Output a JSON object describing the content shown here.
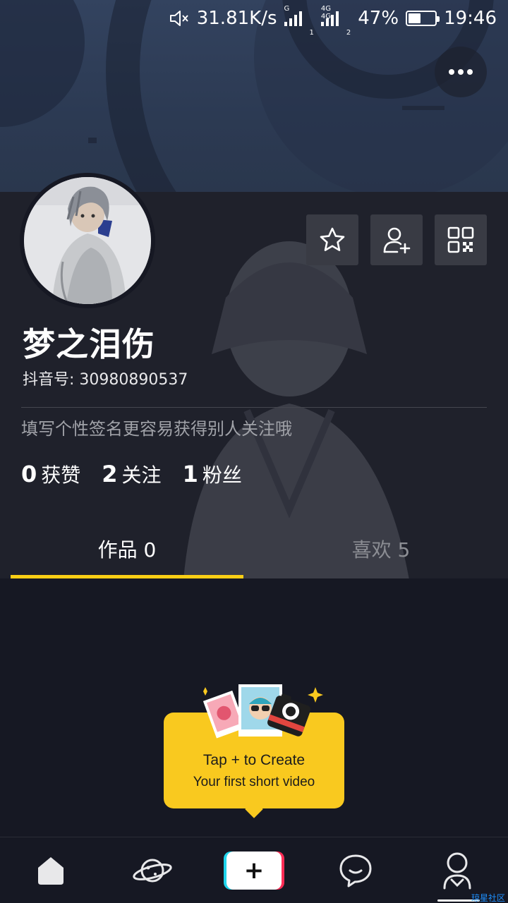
{
  "status_bar": {
    "speed": "31.81K/s",
    "signal1_tag": "G",
    "signal1_sub": "1",
    "signal2_tag": "4G 4G",
    "signal2_sub": "2",
    "battery_percent": "47%",
    "battery_level": 0.47,
    "time": "19:46",
    "icons": [
      "mute-icon",
      "signal-icon",
      "battery-icon"
    ]
  },
  "header": {
    "more_icon": "more-dots-icon"
  },
  "profile": {
    "nickname": "梦之泪伤",
    "douyin_id": "抖音号: 30980890537",
    "bio": "填写个性签名更容易获得别人关注哦",
    "actions": [
      {
        "icon": "star-icon"
      },
      {
        "icon": "add-friend-icon"
      },
      {
        "icon": "qr-code-icon"
      }
    ]
  },
  "stats": [
    {
      "value": "0",
      "label": "获赞"
    },
    {
      "value": "2",
      "label": "关注"
    },
    {
      "value": "1",
      "label": "粉丝"
    }
  ],
  "tabs": [
    {
      "label": "作品 0",
      "active": true
    },
    {
      "label": "喜欢 5",
      "active": false
    }
  ],
  "create_prompt": {
    "line1": "Tap + to Create",
    "line2": "Your first short video"
  },
  "bottom_nav": [
    {
      "icon": "home-icon"
    },
    {
      "icon": "planet-icon"
    },
    {
      "icon": "plus-icon",
      "label": "+"
    },
    {
      "icon": "message-icon"
    },
    {
      "icon": "profile-icon"
    }
  ],
  "watermark": "琼星社区",
  "colors": {
    "accent": "#face15",
    "background": "#161823",
    "card": "#f9c91f",
    "tiktok_cyan": "#20d5ec",
    "tiktok_red": "#fe2c55"
  }
}
